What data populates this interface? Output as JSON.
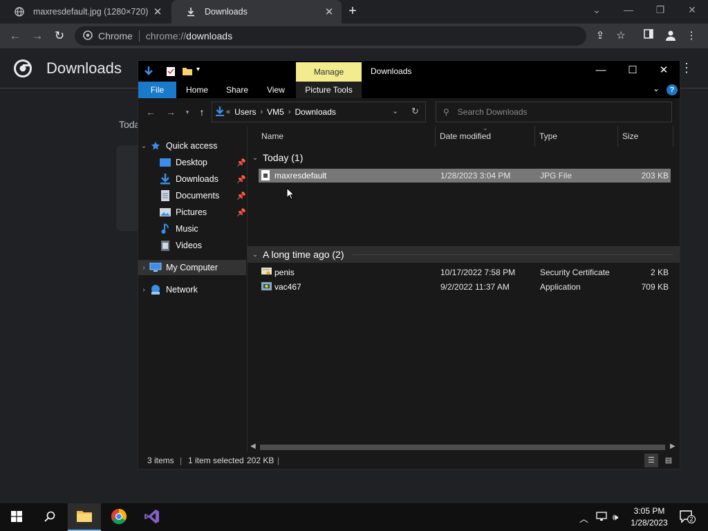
{
  "browser": {
    "tabs": [
      {
        "title": "maxresdefault.jpg (1280×720)",
        "close": "✕"
      },
      {
        "title": "Downloads",
        "close": "✕"
      }
    ],
    "new_tab": "+",
    "omnibox": {
      "chip": "Chrome",
      "scheme": "chrome://",
      "host": "downloads"
    }
  },
  "downloads_page": {
    "title": "Downloads",
    "section_label": "Toda"
  },
  "explorer": {
    "window_title": "Downloads",
    "manage_label": "Manage",
    "ribbon_tabs": [
      "File",
      "Home",
      "Share",
      "View",
      "Picture Tools"
    ],
    "breadcrumb": {
      "overflow": "«",
      "items": [
        "Users",
        "VM5",
        "Downloads"
      ]
    },
    "search_placeholder": "Search Downloads",
    "nav": {
      "quick_access": "Quick access",
      "items": [
        "Desktop",
        "Downloads",
        "Documents",
        "Pictures",
        "Music",
        "Videos"
      ],
      "my_computer": "My Computer",
      "network": "Network"
    },
    "columns": [
      "Name",
      "Date modified",
      "Type",
      "Size"
    ],
    "groups": [
      {
        "label": "Today (1)",
        "files": [
          {
            "name": "maxresdefault",
            "date": "1/28/2023 3:04 PM",
            "type": "JPG File",
            "size": "203 KB"
          }
        ]
      },
      {
        "label": "A long time ago (2)",
        "files": [
          {
            "name": "penis",
            "date": "10/17/2022 7:58 PM",
            "type": "Security Certificate",
            "size": "2 KB"
          },
          {
            "name": "vac467",
            "date": "9/2/2022 11:37 AM",
            "type": "Application",
            "size": "709 KB"
          }
        ]
      }
    ],
    "status": {
      "items": "3 items",
      "selected": "1 item selected",
      "size": "202 KB"
    }
  },
  "taskbar": {
    "clock_time": "3:05 PM",
    "clock_date": "1/28/2023",
    "notification_count": "2"
  },
  "colors": {
    "accent_blue": "#1979ca",
    "manage_yellow": "#f2ec8f",
    "selection": "#777777"
  }
}
